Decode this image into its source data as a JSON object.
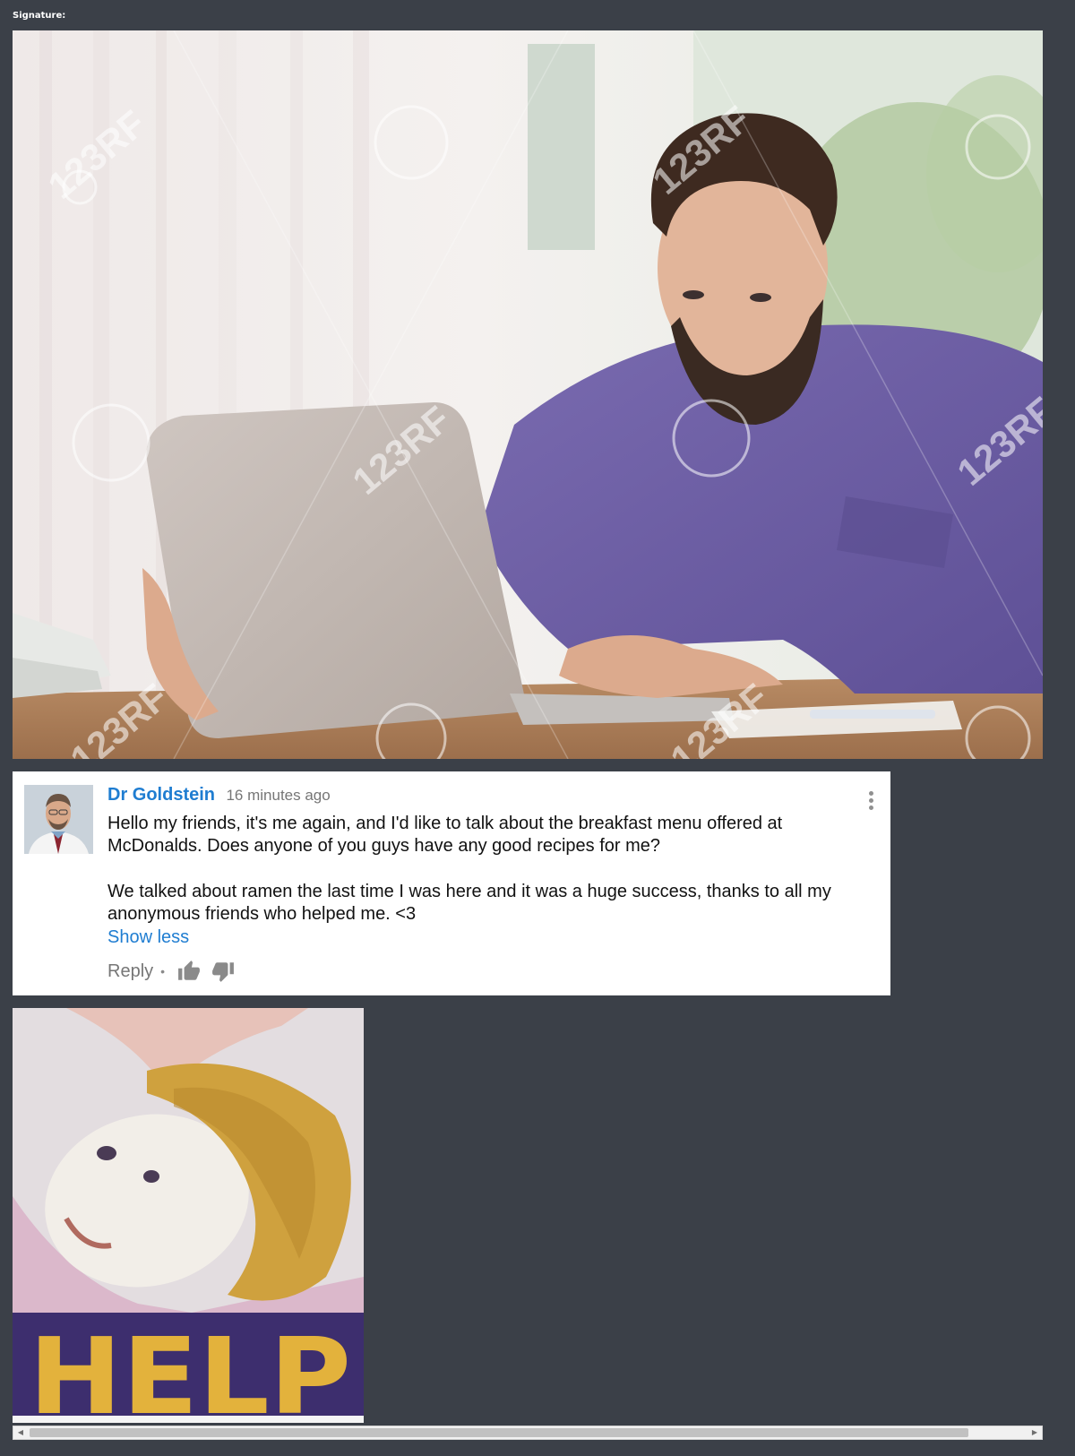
{
  "signature": {
    "label": "Signature:"
  },
  "photo": {
    "description_icon": "man-with-laptop-photo",
    "watermark": "123RF"
  },
  "comment": {
    "author": "Dr Goldstein",
    "timestamp": "16 minutes ago",
    "paragraphs": [
      "Hello my friends, it's me again, and I'd like to talk about the breakfast menu offered at McDonalds. Does anyone of you guys have any good recipes for me?",
      "We talked about ramen the last time I was here and it was a huge success, thanks to all my anonymous friends who helped me. <3"
    ],
    "show_less_label": "Show less",
    "reply_label": "Reply",
    "separator": "•"
  },
  "meme": {
    "text": "HELP"
  },
  "scrollbar": {
    "left_arrow": "◀",
    "right_arrow": "▶"
  },
  "colors": {
    "background": "#3b4048",
    "link": "#1f7dd1",
    "card": "#ffffff"
  }
}
